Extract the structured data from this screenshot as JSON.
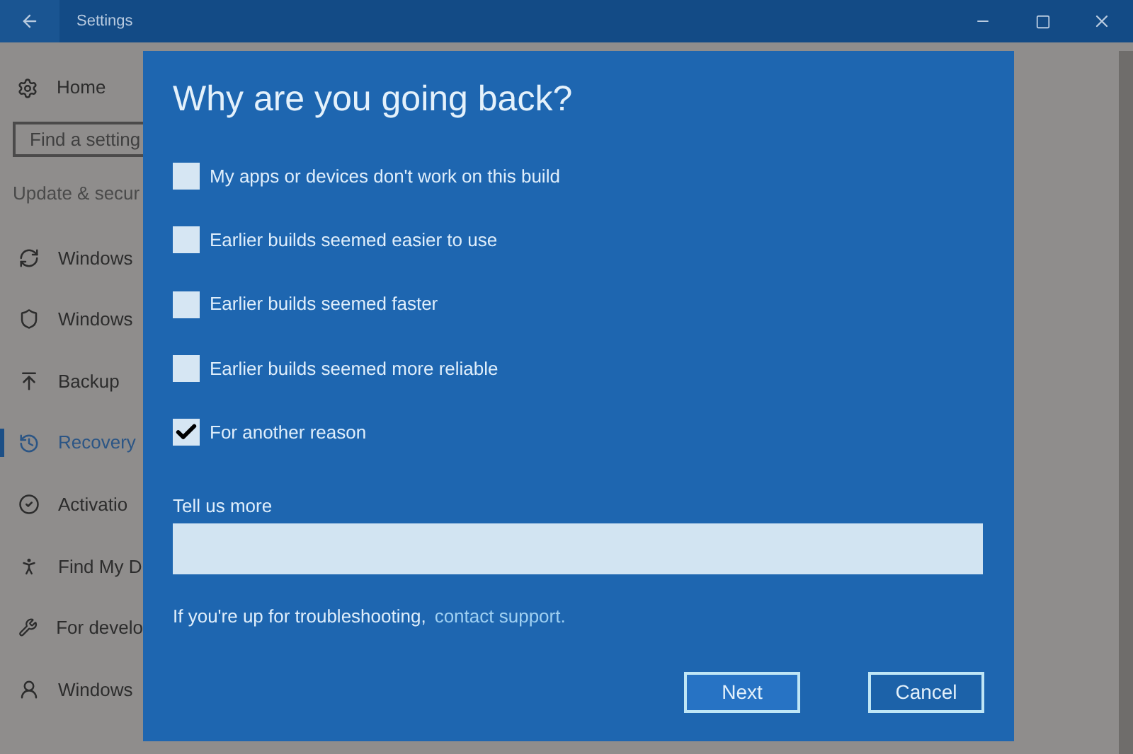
{
  "window": {
    "title": "Settings"
  },
  "sidebar": {
    "home": "Home",
    "search": {
      "placeholder": "Find a setting"
    },
    "section": "Update & secur",
    "items": [
      {
        "label": "Windows",
        "selected": false
      },
      {
        "label": "Windows",
        "selected": false
      },
      {
        "label": "Backup",
        "selected": false
      },
      {
        "label": "Recovery",
        "selected": true
      },
      {
        "label": "Activatio",
        "selected": false
      },
      {
        "label": "Find My D",
        "selected": false
      },
      {
        "label": "For develo",
        "selected": false
      },
      {
        "label": "Windows",
        "selected": false
      }
    ]
  },
  "dialog": {
    "title": "Why are you going back?",
    "options": [
      {
        "label": "My apps or devices don't work on this build",
        "checked": false
      },
      {
        "label": "Earlier builds seemed easier to use",
        "checked": false
      },
      {
        "label": "Earlier builds seemed faster",
        "checked": false
      },
      {
        "label": "Earlier builds seemed more reliable",
        "checked": false
      },
      {
        "label": "For another reason",
        "checked": true
      }
    ],
    "field_label": "Tell us more",
    "hint": "If you're up for troubleshooting,",
    "link": "contact support.",
    "buttons": [
      {
        "label": "Next",
        "selected": true
      },
      {
        "label": "Cancel",
        "selected": false
      }
    ]
  }
}
